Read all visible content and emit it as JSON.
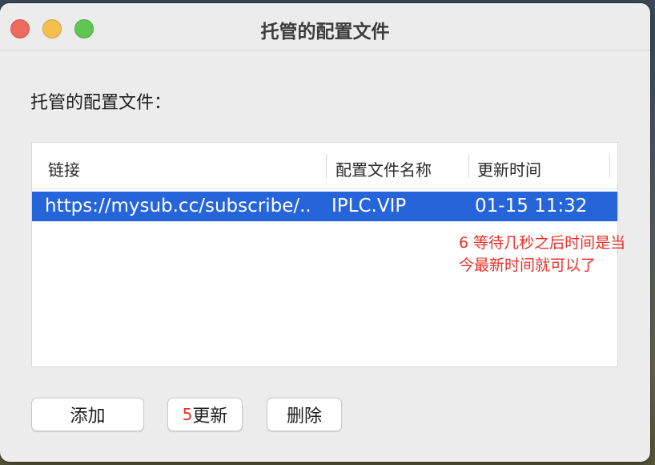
{
  "window": {
    "title": "托管的配置文件"
  },
  "section": {
    "label": "托管的配置文件："
  },
  "table": {
    "columns": [
      "链接",
      "配置文件名称",
      "更新时间"
    ],
    "rows": [
      {
        "link": "https://mysub.cc/subscribe/..",
        "name": "IPLC.VIP",
        "updated": "01-15 11:32"
      }
    ]
  },
  "annotation": {
    "line1": "6 等待几秒之后时间是当",
    "line2": "今最新时间就可以了"
  },
  "buttons": {
    "add": "添加",
    "update_prefix": "5",
    "update": "更新",
    "delete": "删除"
  },
  "colors": {
    "selection": "#2564d9",
    "annotation": "#e8302a"
  }
}
